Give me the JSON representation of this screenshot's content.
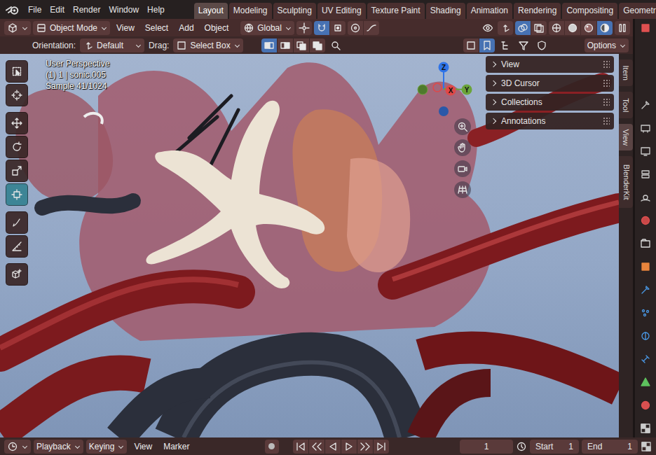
{
  "topbar": {
    "menus": [
      "File",
      "Edit",
      "Render",
      "Window",
      "Help"
    ],
    "workspaces": [
      {
        "label": "Layout",
        "selected": true
      },
      {
        "label": "Modeling",
        "selected": false
      },
      {
        "label": "Sculpting",
        "selected": false
      },
      {
        "label": "UV Editing",
        "selected": false
      },
      {
        "label": "Texture Paint",
        "selected": false
      },
      {
        "label": "Shading",
        "selected": false
      },
      {
        "label": "Animation",
        "selected": false
      },
      {
        "label": "Rendering",
        "selected": false
      },
      {
        "label": "Compositing",
        "selected": false
      },
      {
        "label": "Geometr",
        "selected": false
      }
    ]
  },
  "header": {
    "mode": "Object Mode",
    "menus": [
      "View",
      "Select",
      "Add",
      "Object"
    ],
    "orientation": "Global",
    "shading": [
      {
        "selected": false
      },
      {
        "selected": false
      },
      {
        "selected": false
      },
      {
        "selected": true
      }
    ]
  },
  "tool_settings": {
    "orientation_label": "Orientation:",
    "orientation": "Default",
    "drag_label": "Drag:",
    "drag": "Select Box",
    "options": "Options",
    "select_modes": [
      {
        "selected": true
      },
      {
        "selected": false
      },
      {
        "selected": false
      },
      {
        "selected": false
      }
    ]
  },
  "viewport": {
    "info": [
      "User Perspective",
      "(1) 1 | sonic.005",
      "Sample 41/1024"
    ],
    "gizmo": {
      "z": "Z",
      "y": "Y",
      "x": "X"
    }
  },
  "toolbar": [
    {
      "tools": [
        {
          "selected": false
        },
        {
          "selected": false
        }
      ]
    },
    {
      "tools": [
        {
          "selected": false
        },
        {
          "selected": false
        },
        {
          "selected": false
        },
        {
          "selected": true
        }
      ]
    },
    {
      "tools": [
        {
          "selected": false
        },
        {
          "selected": false
        }
      ]
    },
    {
      "tools": [
        {
          "selected": false
        }
      ]
    }
  ],
  "sidebar": {
    "panels": [
      {
        "label": "View",
        "expanded": false
      },
      {
        "label": "3D Cursor",
        "expanded": false
      },
      {
        "label": "Collections",
        "expanded": false
      },
      {
        "label": "Annotations",
        "expanded": false
      }
    ],
    "tabs": [
      {
        "label": "Item",
        "selected": false
      },
      {
        "label": "Tool",
        "selected": false
      },
      {
        "label": "View",
        "selected": true
      },
      {
        "label": "BlenderKit",
        "selected": false
      }
    ]
  },
  "timeline": {
    "dropdowns": [
      "Playback",
      "Keying"
    ],
    "menus": [
      "View",
      "Marker"
    ],
    "frame": "1",
    "start_label": "Start",
    "start": "1",
    "end_label": "End",
    "end": "1"
  }
}
